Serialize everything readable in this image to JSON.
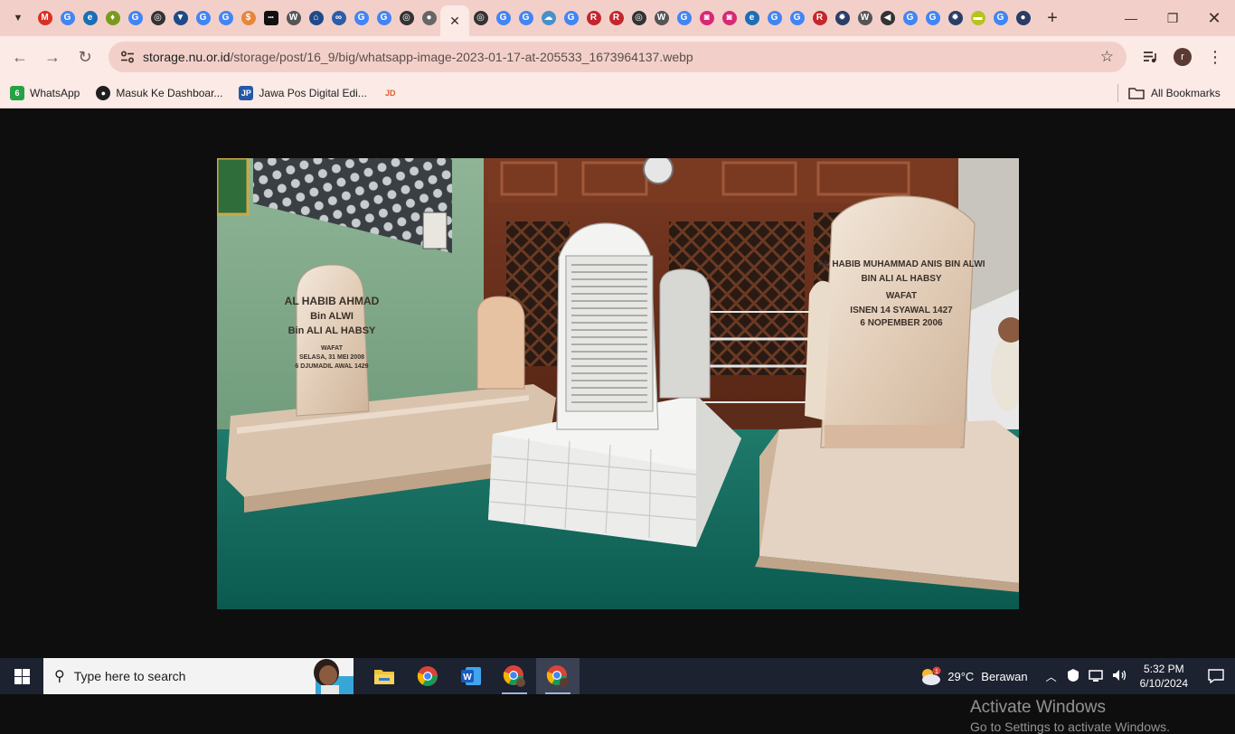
{
  "browser": {
    "tab_favicons": [
      {
        "icon": "gmail-icon",
        "color": "#d93025",
        "glyph": "M"
      },
      {
        "icon": "google-icon",
        "color": "#4285f4",
        "glyph": "G"
      },
      {
        "icon": "edge-icon",
        "color": "#1b6fb5",
        "glyph": "e"
      },
      {
        "icon": "shield-icon",
        "color": "#7a9a1f",
        "glyph": "♦"
      },
      {
        "icon": "google-icon",
        "color": "#4285f4",
        "glyph": "G"
      },
      {
        "icon": "ring-icon",
        "color": "#333333",
        "glyph": "◎"
      },
      {
        "icon": "flag-icon",
        "color": "#1e4a8a",
        "glyph": "▼"
      },
      {
        "icon": "google-icon",
        "color": "#4285f4",
        "glyph": "G"
      },
      {
        "icon": "google-icon",
        "color": "#4285f4",
        "glyph": "G"
      },
      {
        "icon": "dollar-icon",
        "color": "#e8863a",
        "glyph": "$"
      },
      {
        "icon": "dots-icon",
        "color": "#111111",
        "glyph": "•••"
      },
      {
        "icon": "wikipedia-icon",
        "color": "#555555",
        "glyph": "W"
      },
      {
        "icon": "home-icon",
        "color": "#1e4a8a",
        "glyph": "⌂"
      },
      {
        "icon": "binoculars-icon",
        "color": "#2a5ea8",
        "glyph": "∞"
      },
      {
        "icon": "google-icon",
        "color": "#4285f4",
        "glyph": "G"
      },
      {
        "icon": "google-icon",
        "color": "#4285f4",
        "glyph": "G"
      },
      {
        "icon": "ring-icon",
        "color": "#333333",
        "glyph": "◎"
      },
      {
        "icon": "globe-icon",
        "color": "#666666",
        "glyph": "●"
      }
    ],
    "tab_favicons_after": [
      {
        "icon": "ring-icon",
        "color": "#333333",
        "glyph": "◎"
      },
      {
        "icon": "google-icon",
        "color": "#4285f4",
        "glyph": "G"
      },
      {
        "icon": "google-icon",
        "color": "#4285f4",
        "glyph": "G"
      },
      {
        "icon": "cloud-icon",
        "color": "#4a90c8",
        "glyph": "☁"
      },
      {
        "icon": "google-icon",
        "color": "#4285f4",
        "glyph": "G"
      },
      {
        "icon": "r-icon",
        "color": "#c4262e",
        "glyph": "R"
      },
      {
        "icon": "r-icon",
        "color": "#c4262e",
        "glyph": "R"
      },
      {
        "icon": "ring-icon",
        "color": "#333333",
        "glyph": "◎"
      },
      {
        "icon": "wikipedia-icon",
        "color": "#555555",
        "glyph": "W"
      },
      {
        "icon": "google-icon",
        "color": "#4285f4",
        "glyph": "G"
      },
      {
        "icon": "instagram-icon",
        "color": "#d62976",
        "glyph": "◙"
      },
      {
        "icon": "instagram-icon",
        "color": "#d62976",
        "glyph": "◙"
      },
      {
        "icon": "edge-icon",
        "color": "#1b6fb5",
        "glyph": "e"
      },
      {
        "icon": "google-icon",
        "color": "#4285f4",
        "glyph": "G"
      },
      {
        "icon": "google-icon",
        "color": "#4285f4",
        "glyph": "G"
      },
      {
        "icon": "r-icon",
        "color": "#c4262e",
        "glyph": "R"
      },
      {
        "icon": "settings-icon",
        "color": "#2a3d66",
        "glyph": "✹"
      },
      {
        "icon": "wikipedia-icon",
        "color": "#555555",
        "glyph": "W"
      },
      {
        "icon": "speaker-icon",
        "color": "#333333",
        "glyph": "◀"
      },
      {
        "icon": "google-icon",
        "color": "#4285f4",
        "glyph": "G"
      },
      {
        "icon": "google-icon",
        "color": "#4285f4",
        "glyph": "G"
      },
      {
        "icon": "settings-icon",
        "color": "#2a3d66",
        "glyph": "✹"
      },
      {
        "icon": "tv-icon",
        "color": "#b5c41e",
        "glyph": "▬"
      },
      {
        "icon": "google-icon",
        "color": "#4285f4",
        "glyph": "G"
      },
      {
        "icon": "badge-icon",
        "color": "#2a3d66",
        "glyph": "●"
      }
    ],
    "active_tab_close": "✕",
    "new_tab": "+",
    "url": {
      "host": "storage.nu.or.id",
      "path": "/storage/post/16_9/big/whatsapp-image-2023-01-17-at-205533_1673964137.webp"
    },
    "profile_initial": "r",
    "bookmarks": [
      {
        "label": "WhatsApp",
        "icon": "whatsapp-icon",
        "color": "#25a244",
        "glyph": "6"
      },
      {
        "label": "Masuk Ke Dashboar...",
        "icon": "github-icon",
        "color": "#1f1f1f",
        "glyph": "●"
      },
      {
        "label": "Jawa Pos Digital Edi...",
        "icon": "jawapos-icon",
        "color": "#2459a8",
        "glyph": "JP"
      },
      {
        "label": "",
        "icon": "jdih-icon",
        "color": "#e45b2a",
        "glyph": "JD"
      }
    ],
    "all_bookmarks": "All Bookmarks"
  },
  "watermark": {
    "title": "Activate Windows",
    "subtitle": "Go to Settings to activate Windows."
  },
  "photo": {
    "left_stone": [
      "AL HABIB AHMAD",
      "Bin ALWI",
      "Bin ALI AL HABSY",
      "WAFAT",
      "SELASA, 31 MEI 2008",
      "6 DJUMADIL AWAL 1429"
    ],
    "right_stone": [
      "AL HABIB MUHAMMAD ANIS BIN ALWI",
      "BIN ALI AL HABSY",
      "WAFAT",
      "ISNEN 14 SYAWAL 1427",
      "6 NOPEMBER 2006"
    ]
  },
  "taskbar": {
    "search_placeholder": "Type here to search",
    "weather_temp": "29°C",
    "weather_desc": "Berawan",
    "weather_badge": "1",
    "time": "5:32 PM",
    "date": "6/10/2024"
  }
}
